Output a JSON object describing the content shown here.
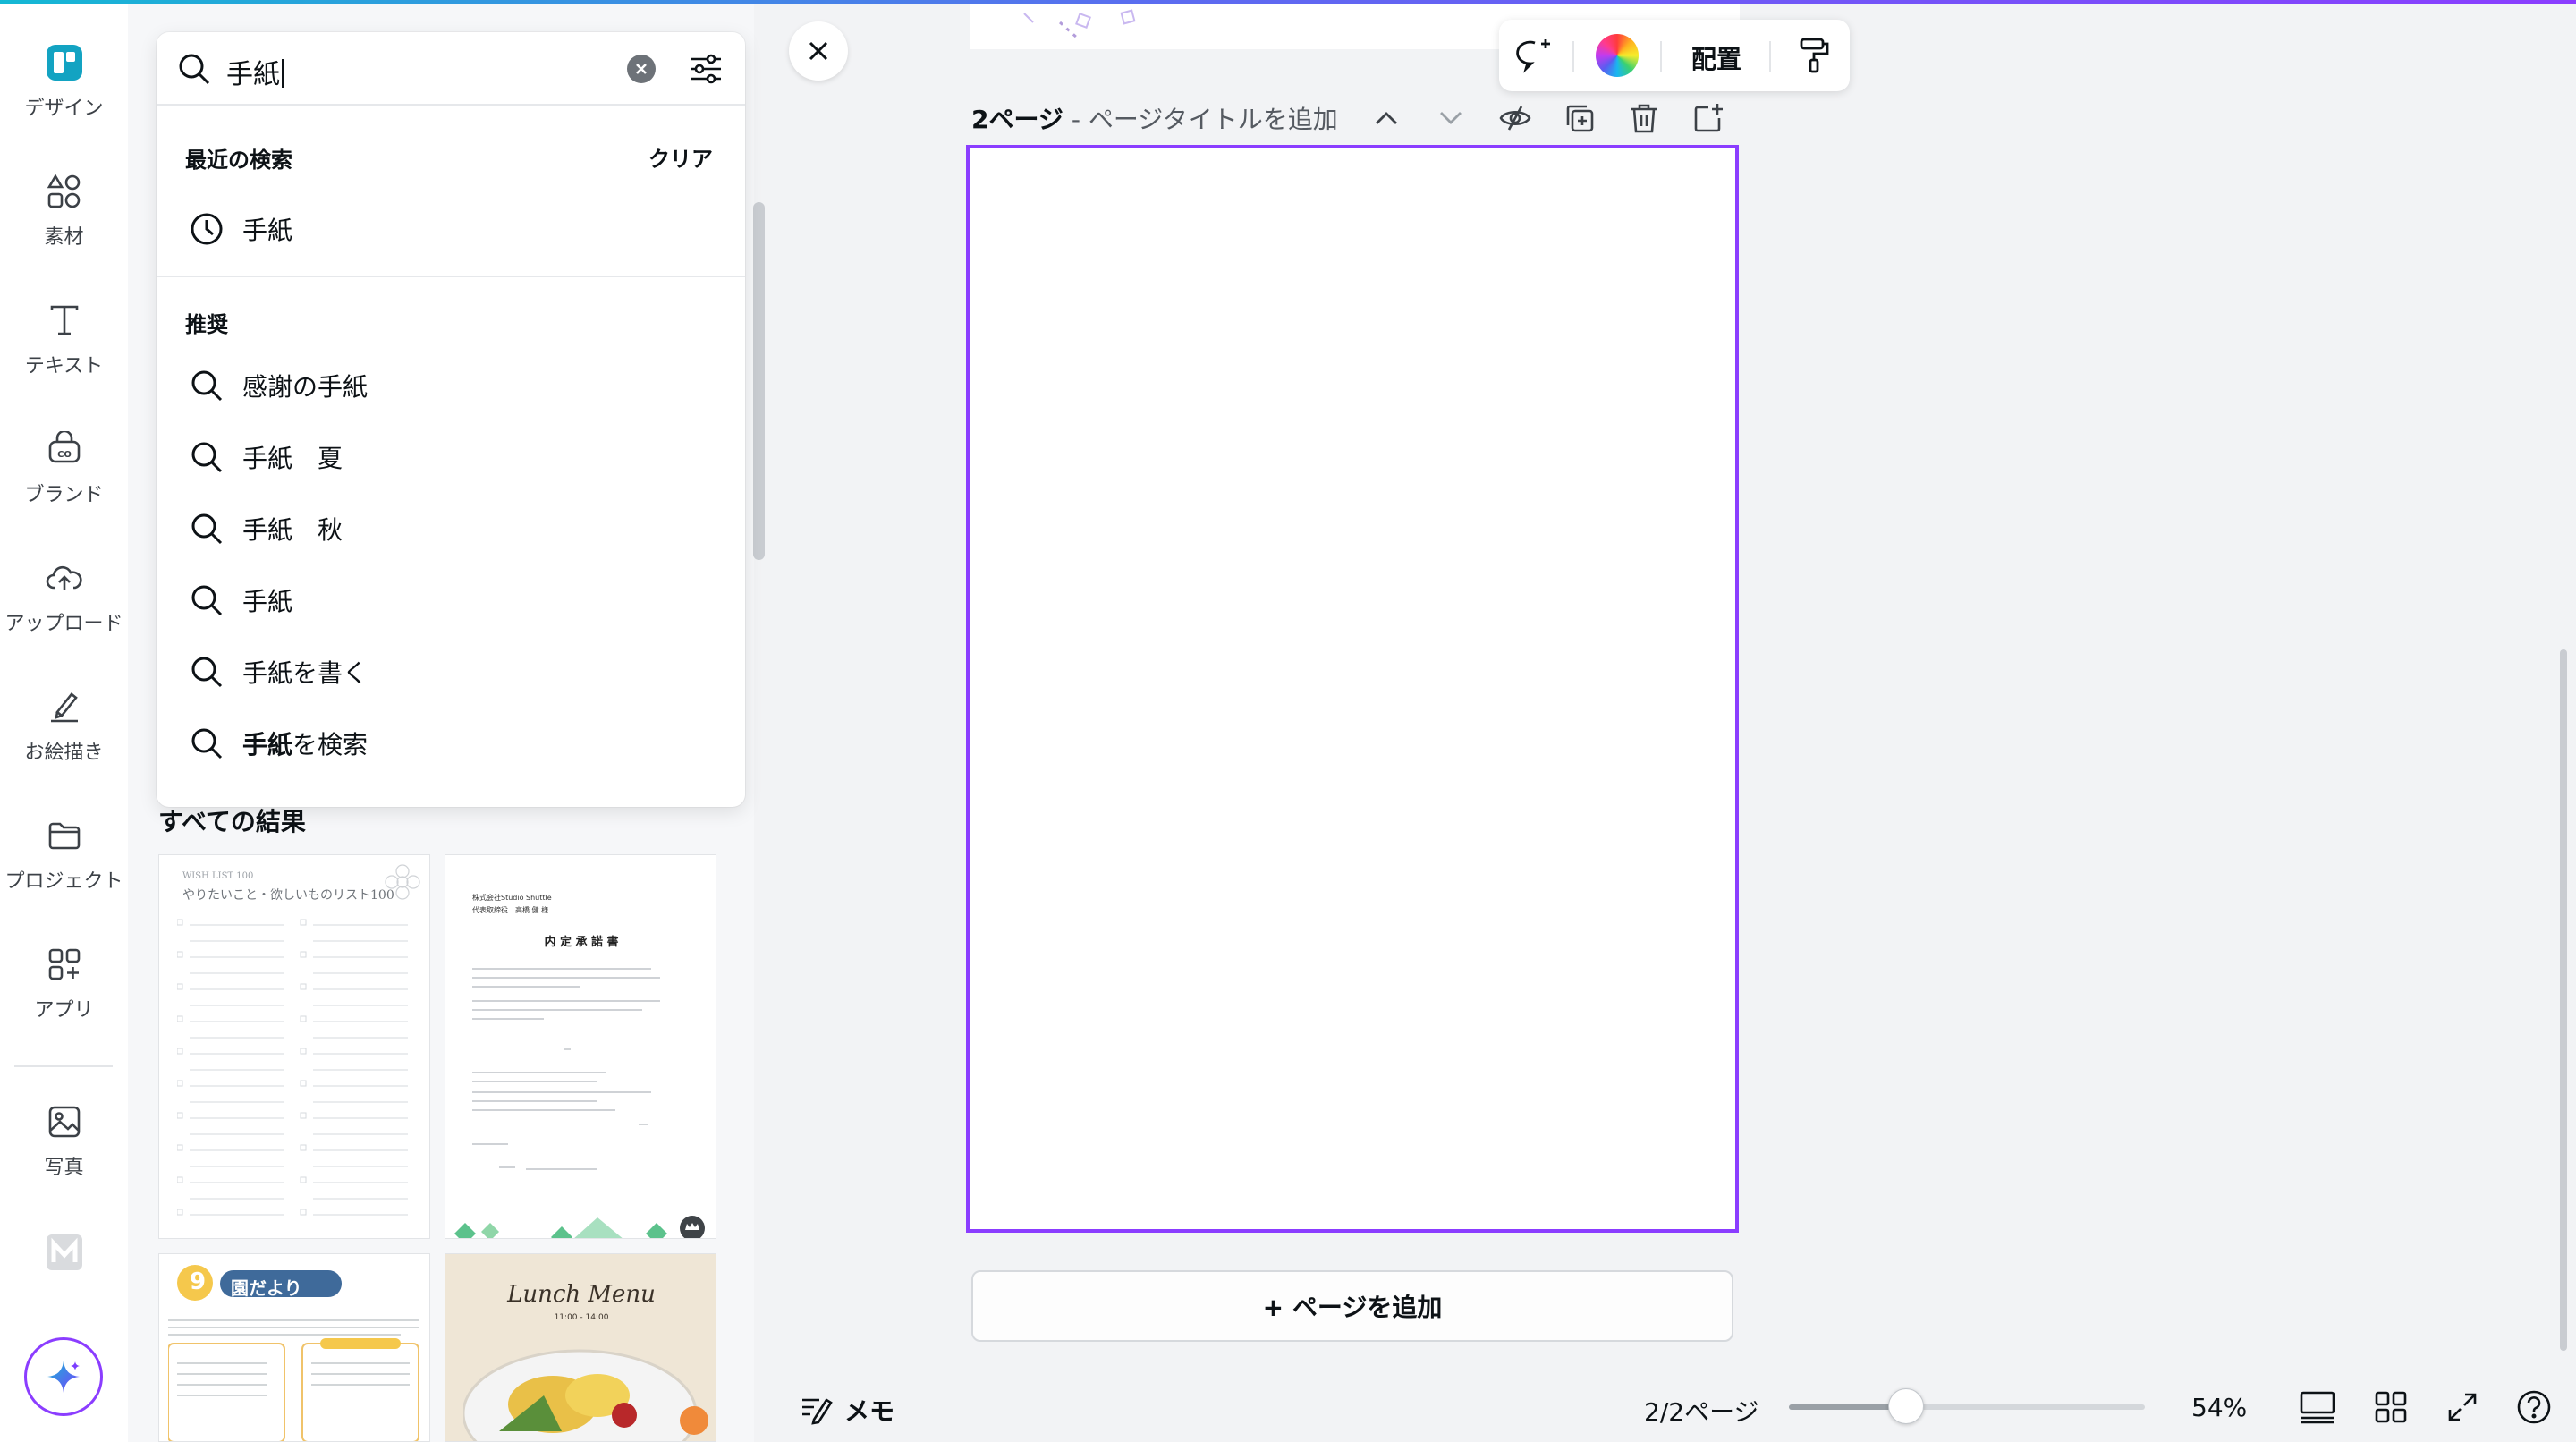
{
  "rail": {
    "items": [
      {
        "label": "デザイン",
        "icon": "design-icon"
      },
      {
        "label": "素材",
        "icon": "elements-icon"
      },
      {
        "label": "テキスト",
        "icon": "text-icon"
      },
      {
        "label": "ブランド",
        "icon": "brand-icon"
      },
      {
        "label": "アップロード",
        "icon": "upload-cloud-icon"
      },
      {
        "label": "お絵描き",
        "icon": "draw-icon"
      },
      {
        "label": "プロジェクト",
        "icon": "folder-icon"
      },
      {
        "label": "アプリ",
        "icon": "apps-icon"
      },
      {
        "label": "写真",
        "icon": "photo-icon"
      }
    ],
    "magic_icon": "sparkle-icon"
  },
  "search": {
    "value": "手紙",
    "recent_title": "最近の検索",
    "clear_label": "クリア",
    "recent": [
      "手紙"
    ],
    "suggest_title": "推奨",
    "suggestions": [
      "感謝の手紙",
      "手紙　夏",
      "手紙　秋",
      "手紙",
      "手紙を書く"
    ],
    "search_for_bold": "手紙",
    "search_for_rest": "を検索"
  },
  "results": {
    "title": "すべての結果",
    "thumb1": {
      "header": "WISH LIST 100",
      "title": "やりたいこと・欲しいものリスト100"
    },
    "thumb2": {
      "company": "株式会社Studio Shuttle",
      "name": "代表取締役　高橋 健 様",
      "title": "内 定 承 諾 書"
    },
    "thumb3": {
      "badge": "9",
      "title": "園だより"
    },
    "thumb4": {
      "title": "Lunch Menu",
      "sub": "11:00 - 14:00"
    }
  },
  "toolbar": {
    "arrange_label": "配置"
  },
  "page_header": {
    "page_no": "2ページ",
    "title_placeholder": "- ページタイトルを追加"
  },
  "add_page_label": "+ ページを追加",
  "bottom": {
    "memo_label": "メモ",
    "pages": "2/2ページ",
    "zoom": "54%",
    "zoom_fraction": 0.33
  },
  "colors": {
    "accent": "#8b3dff",
    "brand_teal": "#14b8d4"
  }
}
